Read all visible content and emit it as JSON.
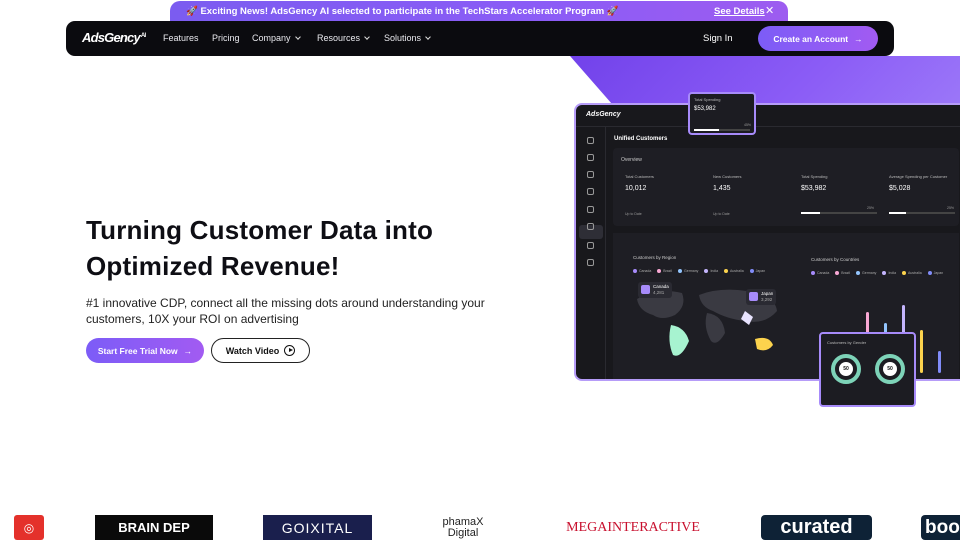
{
  "announcement": {
    "text": "🚀 Exciting News! AdsGency AI selected to participate in the TechStars Accelerator Program 🚀",
    "link": "See Details"
  },
  "nav": {
    "logo": "AdsGency",
    "logo_suffix": "AI",
    "items": [
      {
        "label": "Features",
        "dropdown": false
      },
      {
        "label": "Pricing",
        "dropdown": false
      },
      {
        "label": "Company",
        "dropdown": true
      },
      {
        "label": "Resources",
        "dropdown": true
      },
      {
        "label": "Solutions",
        "dropdown": true
      }
    ],
    "sign_in": "Sign In",
    "cta": "Create an Account"
  },
  "hero": {
    "title_line1": "Turning Customer Data into",
    "title_line2": "Optimized Revenue!",
    "subtitle": "#1 innovative CDP, connect all the missing dots around understanding your customers, 10X your ROI on advertising",
    "primary_button": "Start Free Trial Now",
    "secondary_button": "Watch Video"
  },
  "dashboard": {
    "logo": "AdsGency",
    "page_title": "Unified Customers",
    "overview_title": "Overview",
    "stats": [
      {
        "label": "Total Customers",
        "value": "10,012",
        "foot": "Up to Date"
      },
      {
        "label": "New Customers",
        "value": "1,435",
        "foot": "Up to Date"
      },
      {
        "label": "Total Spending",
        "value": "$53,982",
        "foot": "",
        "progress": "25%",
        "progress_value": 0.25
      },
      {
        "label": "Average Spending per Customer",
        "value": "$5,028",
        "foot": "",
        "progress": "25%",
        "progress_value": 0.25
      }
    ],
    "region_title": "Customers by Region",
    "countries_title": "Customers by Countries",
    "legend": [
      {
        "name": "Canada",
        "color": "#a78bfa"
      },
      {
        "name": "Brazil",
        "color": "#f9a8d4"
      },
      {
        "name": "Germany",
        "color": "#93c5fd"
      },
      {
        "name": "India",
        "color": "#c4b5fd"
      },
      {
        "name": "Australia",
        "color": "#fcd34d"
      },
      {
        "name": "Japan",
        "color": "#818cf8"
      }
    ],
    "pins": [
      {
        "country": "Canada",
        "value": "4,281"
      },
      {
        "country": "Japan",
        "value": "3,292"
      }
    ],
    "bar_levels": [
      0.55,
      0.85,
      0.7,
      0.95,
      0.6,
      0.3
    ],
    "spend_card": {
      "label": "Total Spending",
      "value": "$53,982",
      "progress": "45%",
      "progress_value": 0.45
    },
    "gender_card": {
      "title": "Customers by Gender",
      "left": "50",
      "right": "50"
    }
  },
  "logos": [
    "BRAIN DEP",
    "GOIXITAL",
    "phamaX",
    "Digital",
    "MEGAINTERACTIVE",
    "curated",
    "boo"
  ]
}
